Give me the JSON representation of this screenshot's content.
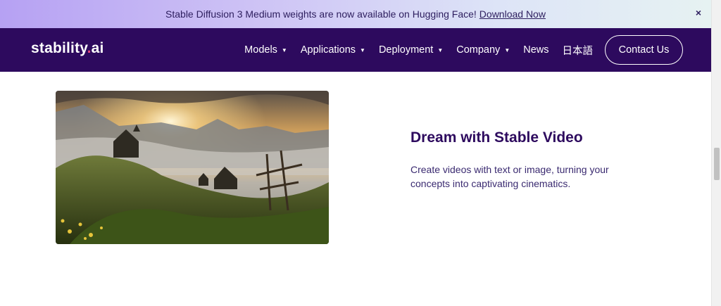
{
  "banner": {
    "message": "Stable Diffusion 3 Medium weights are now available on Hugging Face!",
    "link_label": "Download Now",
    "close_label": "×"
  },
  "nav": {
    "logo_main": "stability",
    "logo_dot": ".",
    "logo_suffix": "ai",
    "items": [
      {
        "label": "Models",
        "has_dropdown": true
      },
      {
        "label": "Applications",
        "has_dropdown": true
      },
      {
        "label": "Deployment",
        "has_dropdown": true
      },
      {
        "label": "Company",
        "has_dropdown": true
      },
      {
        "label": "News",
        "has_dropdown": false
      },
      {
        "label": "日本語",
        "has_dropdown": false
      }
    ],
    "dropdown_caret": "▼",
    "contact_label": "Contact Us"
  },
  "content": {
    "title": "Dream with Stable Video",
    "description": "Create videos with text or image, turning your concepts into captivating cinematics."
  },
  "colors": {
    "nav_bg": "#2d0a5e",
    "title": "#2d0a5e",
    "logo_dot": "#e0457b"
  }
}
